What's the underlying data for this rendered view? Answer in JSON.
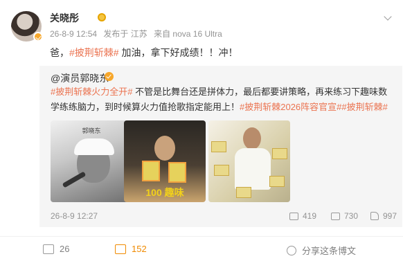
{
  "post": {
    "author": "关晓彤",
    "meta": {
      "time": "26-8-9 12:54",
      "location": "发布于 江苏",
      "device": "来自 nova 16 Ultra"
    },
    "text_prefix": "爸，",
    "hashtag": "#披荆斩棘#",
    "text_suffix": " 加油，拿下好成绩！！冲！"
  },
  "repost": {
    "author": "@演员郭晓东",
    "hashtag1": "#披荆斩棘火力全开#",
    "text_middle": " 不管是比舞台还是拼体力，最后都要讲策略，再来练习下趣味数学练练脑力，到时候算火力值抢歌指定能用上！",
    "hashtag2": "#披荆斩棘2026阵容官宣#",
    "hashtag3": "#披荆斩棘#",
    "images": [
      {
        "caption": "郭晓东"
      },
      {
        "caption": "100 趣味"
      },
      {
        "caption": ""
      }
    ],
    "time": "26-8-9 12:27",
    "stats": {
      "reposts": "419",
      "comments": "730",
      "likes": "997"
    }
  },
  "footer": {
    "reposts": "26",
    "comments": "152",
    "share_label": "分享这条博文"
  },
  "colors": {
    "accent": "#eb7350",
    "comment_active": "#f08a00",
    "repost_bg": "#f5f5f5",
    "meta_text": "#939393"
  },
  "icons": [
    "more-chevron-icon",
    "verified-badge-icon",
    "medal-icon",
    "repost-icon",
    "comment-icon",
    "like-icon",
    "share-icon"
  ]
}
